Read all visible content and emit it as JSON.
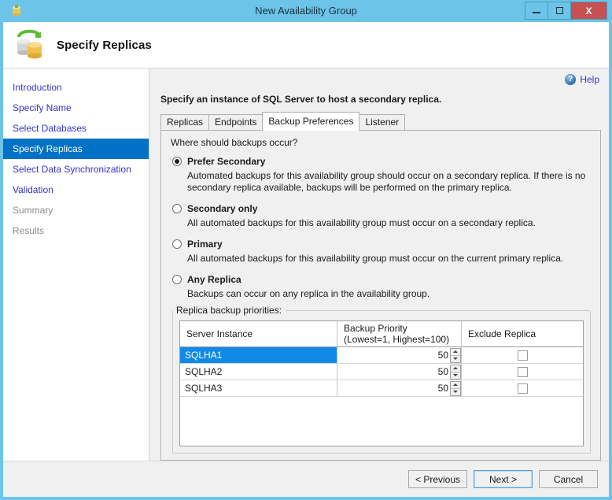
{
  "window": {
    "title": "New Availability Group",
    "icon": "database-yellow-icon",
    "controls": {
      "minimize": "minimize-icon",
      "maximize": "maximize-icon",
      "close": "X"
    }
  },
  "header": {
    "title": "Specify Replicas",
    "icon": "replica-sync-icon"
  },
  "sidebar": {
    "items": [
      {
        "label": "Introduction",
        "state": "link"
      },
      {
        "label": "Specify Name",
        "state": "link"
      },
      {
        "label": "Select Databases",
        "state": "link"
      },
      {
        "label": "Specify Replicas",
        "state": "active"
      },
      {
        "label": "Select Data Synchronization",
        "state": "link"
      },
      {
        "label": "Validation",
        "state": "link"
      },
      {
        "label": "Summary",
        "state": "disabled"
      },
      {
        "label": "Results",
        "state": "disabled"
      }
    ]
  },
  "content": {
    "help_label": "Help",
    "help_icon": "help-circle-icon",
    "instruction": "Specify an instance of SQL Server to host a secondary replica.",
    "tabs": [
      {
        "label": "Replicas",
        "active": false
      },
      {
        "label": "Endpoints",
        "active": false
      },
      {
        "label": "Backup Preferences",
        "active": true
      },
      {
        "label": "Listener",
        "active": false
      }
    ],
    "panel_question": "Where should backups occur?",
    "options": [
      {
        "label": "Prefer Secondary",
        "selected": true,
        "description": "Automated backups for this availability group should occur on a secondary replica. If there is no secondary replica available, backups will be performed on the primary replica."
      },
      {
        "label": "Secondary only",
        "selected": false,
        "description": "All automated backups for this availability group must occur on a secondary replica."
      },
      {
        "label": "Primary",
        "selected": false,
        "description": "All automated backups for this availability group must occur on the current primary replica."
      },
      {
        "label": "Any Replica",
        "selected": false,
        "description": "Backups can occur on any replica in the availability group."
      }
    ],
    "groupbox_label": "Replica backup priorities:",
    "grid": {
      "columns": [
        {
          "label": "Server Instance",
          "sublabel": ""
        },
        {
          "label": "Backup Priority",
          "sublabel": "(Lowest=1, Highest=100)"
        },
        {
          "label": "Exclude Replica",
          "sublabel": ""
        }
      ],
      "rows": [
        {
          "server": "SQLHA1",
          "priority": "50",
          "exclude": false,
          "selected": true
        },
        {
          "server": "SQLHA2",
          "priority": "50",
          "exclude": false,
          "selected": false
        },
        {
          "server": "SQLHA3",
          "priority": "50",
          "exclude": false,
          "selected": false
        }
      ]
    }
  },
  "footer": {
    "previous_label": "< Previous",
    "next_label": "Next >",
    "cancel_label": "Cancel"
  },
  "colors": {
    "titlebar": "#6cc4e8",
    "accent_selected": "#0072c6",
    "grid_selected": "#0f8ae8",
    "link": "#3333cc",
    "close_button": "#c75050"
  }
}
